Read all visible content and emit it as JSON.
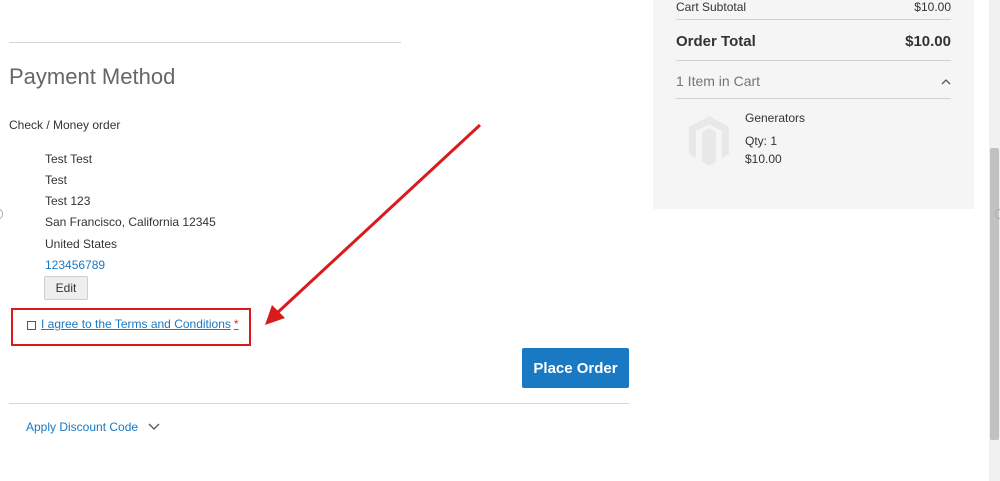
{
  "payment": {
    "title": "Payment Method",
    "method_label": "Check / Money order",
    "address": {
      "name": "Test Test",
      "company": "Test",
      "street": "Test 123",
      "city_line": "San Francisco, California 12345",
      "country": "United States",
      "phone": "123456789"
    },
    "edit_label": "Edit",
    "terms_label": "I agree to the Terms and Conditions",
    "required_mark": "*",
    "place_order_label": "Place Order",
    "discount_label": "Apply Discount Code"
  },
  "summary": {
    "subtotal_label": "Cart Subtotal",
    "subtotal_value": "$10.00",
    "total_label": "Order Total",
    "total_value": "$10.00",
    "items_in_cart": "1 Item in Cart",
    "item": {
      "name": "Generators",
      "qty": "Qty: 1",
      "price": "$10.00"
    }
  },
  "colors": {
    "accent": "#1979c3",
    "annotation": "#d81b1b",
    "summary_bg": "#f5f5f5"
  }
}
